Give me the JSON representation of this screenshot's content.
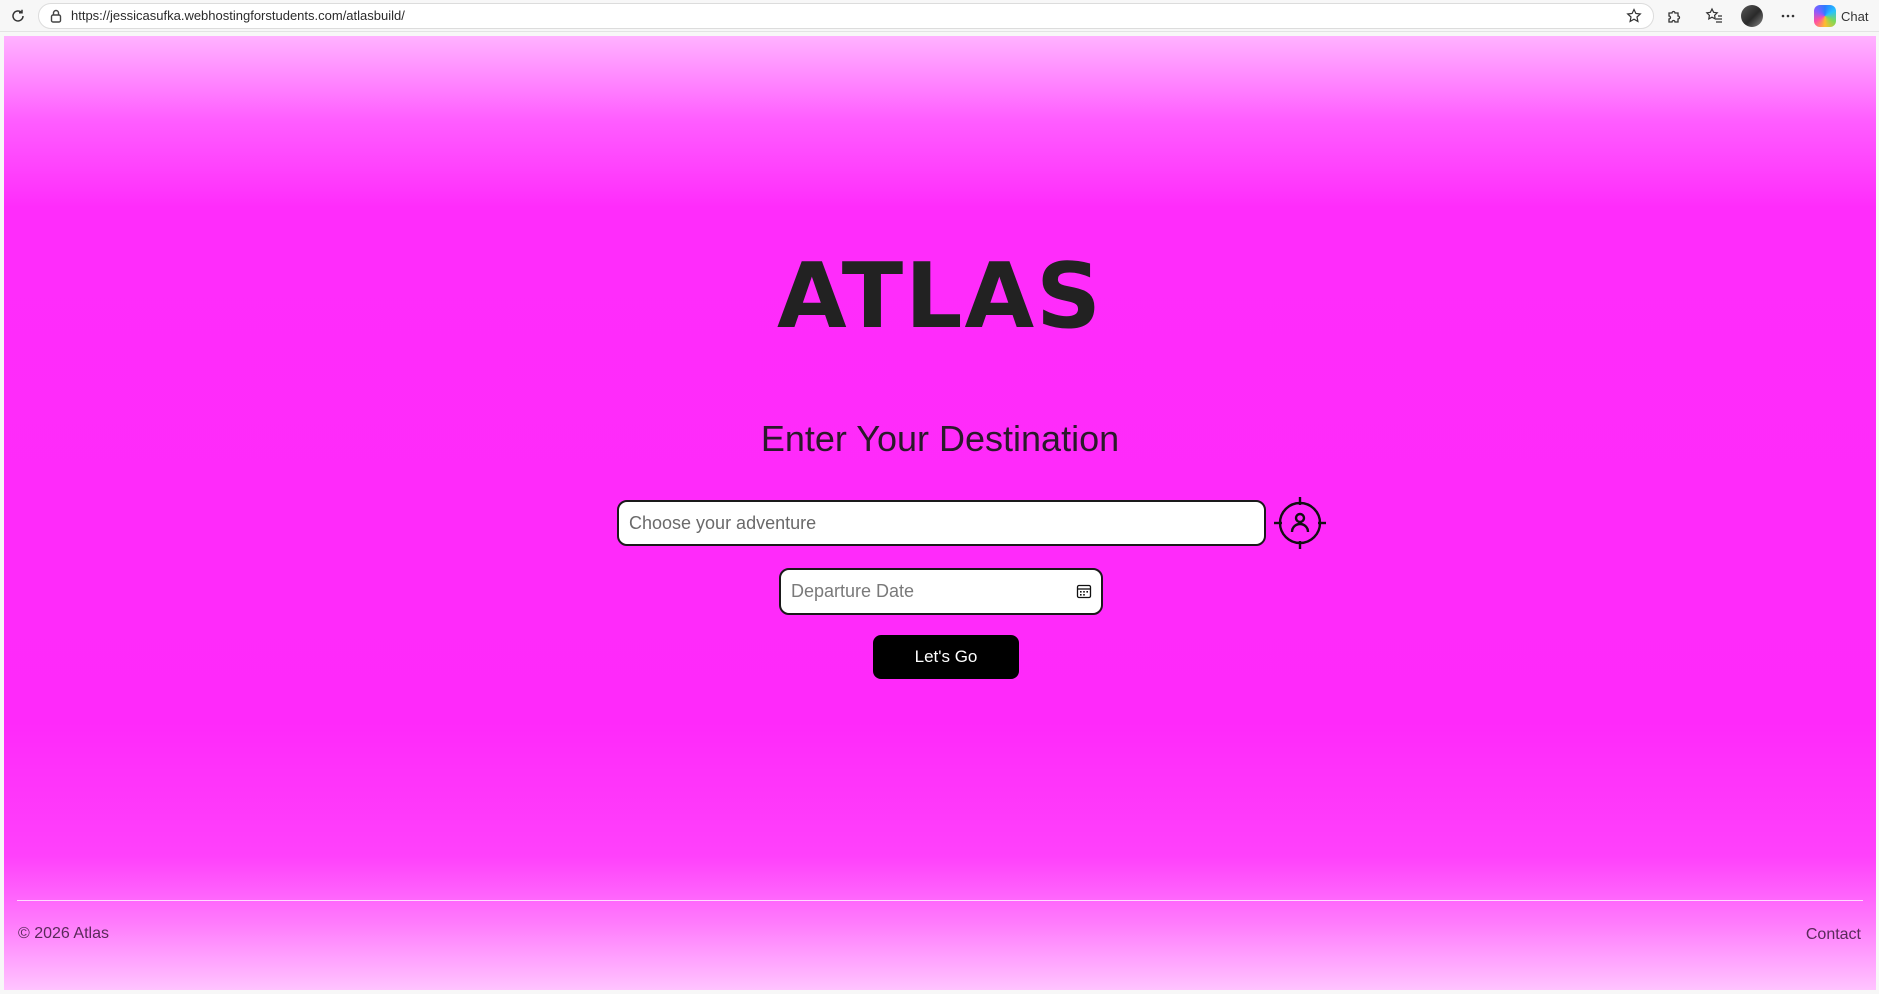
{
  "browser": {
    "url": "https://jessicasufka.webhostingforstudents.com/atlasbuild/",
    "chat_label": "Chat",
    "icons": [
      "reload-icon",
      "lock-icon",
      "star-icon",
      "extensions-icon",
      "favorites-icon",
      "profile-avatar",
      "more-icon",
      "copilot-icon"
    ]
  },
  "page": {
    "logo": "ATLAS",
    "heading": "Enter Your Destination",
    "destination_placeholder": "Choose your adventure",
    "departure_placeholder": "Departure Date",
    "submit_label": "Let's Go",
    "locate_icon": "locate-me-icon",
    "calendar_icon": "calendar-icon"
  },
  "footer": {
    "copyright": "© 2026 Atlas",
    "contact": "Contact"
  },
  "colors": {
    "background": "#ff2cfb",
    "text_dark": "#222222",
    "button": "#000000"
  }
}
